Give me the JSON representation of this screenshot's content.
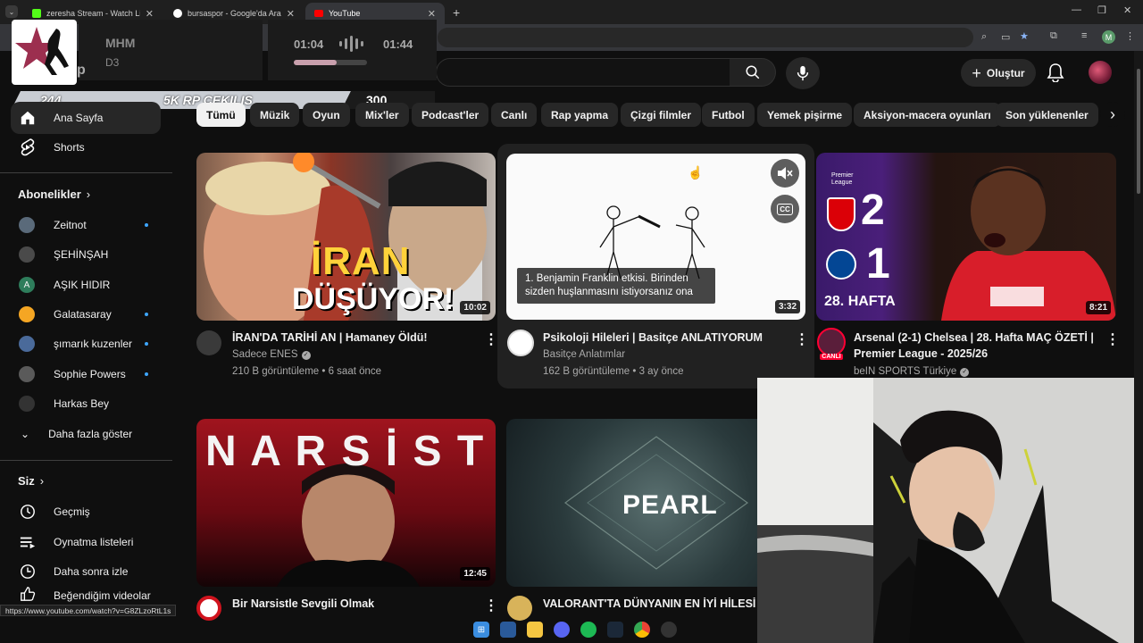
{
  "browser": {
    "tabs": [
      {
        "title": "zeresha Stream - Watch Live on",
        "favicon_color": "#53fc18"
      },
      {
        "title": "bursaspor - Google'da Ara",
        "favicon_color": "#ffffff"
      },
      {
        "title": "YouTube",
        "favicon_color": "#ff0000"
      }
    ],
    "profile_initial": "M"
  },
  "overlay": {
    "song_title": "MHM",
    "song_artist": "D3",
    "time_elapsed": "01:04",
    "time_total": "01:44",
    "progress": 0.58,
    "banner_left": "244",
    "banner_mid": "5K RP CEKILIS",
    "banner_right": "300",
    "logo_text": "p"
  },
  "header": {
    "create_label": "Oluştur"
  },
  "sidebar": {
    "main": [
      {
        "label": "Ana Sayfa",
        "icon": "home-icon"
      },
      {
        "label": "Shorts",
        "icon": "shorts-icon"
      }
    ],
    "subs_heading": "Abonelikler",
    "subscriptions": [
      {
        "label": "Zeitnot",
        "dot": true,
        "color": "#5a6a7a"
      },
      {
        "label": "ŞEHİNŞAH",
        "dot": false,
        "color": "#4a4a4a"
      },
      {
        "label": "AŞIK HIDIR",
        "dot": false,
        "color": "#2e7d5b",
        "letter": "A"
      },
      {
        "label": "Galatasaray",
        "dot": true,
        "color": "#f5a623"
      },
      {
        "label": "şımarık kuzenler",
        "dot": true,
        "color": "#4a6a9a"
      },
      {
        "label": "Sophie Powers",
        "dot": true,
        "color": "#5a5a5a"
      },
      {
        "label": "Harkas Bey",
        "dot": false,
        "color": "#333"
      }
    ],
    "more_label": "Daha fazla göster",
    "you_heading": "Siz",
    "you_items": [
      {
        "label": "Geçmiş",
        "icon": "history-icon"
      },
      {
        "label": "Oynatma listeleri",
        "icon": "playlists-icon"
      },
      {
        "label": "Daha sonra izle",
        "icon": "watch-later-icon"
      },
      {
        "label": "Beğendiğim videolar",
        "icon": "liked-icon"
      }
    ]
  },
  "chips": [
    "Tümü",
    "Müzik",
    "Oyun",
    "Mix'ler",
    "Podcast'ler",
    "Canlı",
    "Rap yapma",
    "Çizgi filmler",
    "Futbol",
    "Yemek pişirme",
    "Aksiyon-macera oyunları",
    "Son yüklenenler"
  ],
  "videos": [
    {
      "title": "İRAN'DA TARİHİ AN | Hamaney Öldü!",
      "channel": "Sadece ENES",
      "meta": "210 B görüntüleme • 6 saat önce",
      "duration": "10:02",
      "thumb_text_1": "İRAN",
      "thumb_text_2": "DÜŞÜYOR!"
    },
    {
      "title": "Psikoloji Hileleri | Basitçe ANLATIYORUM",
      "channel": "Basitçe Anlatımlar",
      "meta": "162 B görüntüleme • 3 ay önce",
      "duration": "3:32",
      "caption": "1. Benjamin Franklin etkisi. Birinden sizden huşlanmasını istiyorsanız ona",
      "cc": "CC"
    },
    {
      "title": "Arsenal (2-1) Chelsea | 28. Hafta MAÇ ÖZETİ | Premier League - 2025/26",
      "channel": "beIN SPORTS Türkiye",
      "meta": "",
      "duration": "8:21",
      "badge": "CANLI",
      "score_home": "2",
      "score_away": "1",
      "week": "28. HAFTA",
      "league": "Premier League"
    },
    {
      "title": "Bir Narsistle Sevgili Olmak",
      "channel": "",
      "meta": "",
      "duration": "12:45",
      "thumb_text_1": "N A R S İ S T"
    },
    {
      "title": "VALORANT'TA DÜNYANIN EN İYİ HİLESİ",
      "channel": "",
      "meta": "",
      "duration": "",
      "thumb_text_1": "PEARL"
    }
  ],
  "status_url": "https://www.youtube.com/watch?v=G8ZLzoRtL1s",
  "colors": {
    "accent": "#3ea6ff",
    "yt_red": "#ff0000",
    "bg": "#0f0f0f"
  }
}
